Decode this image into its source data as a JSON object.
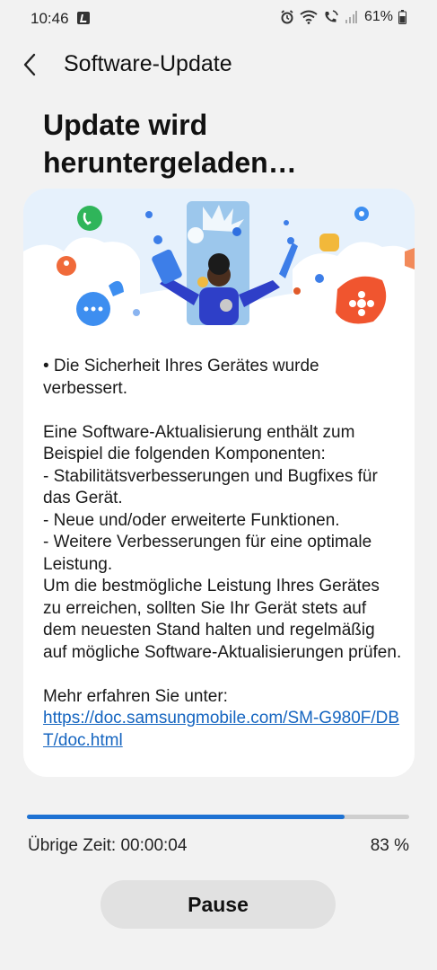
{
  "status_bar": {
    "time": "10:46",
    "battery_percent": "61%",
    "icons": [
      "music-note-icon",
      "alarm-icon",
      "wifi-icon",
      "wifi-call-icon",
      "signal-icon",
      "battery-icon"
    ]
  },
  "header": {
    "title": "Software-Update",
    "back_icon": "chevron-left-icon"
  },
  "headline": "Update wird heruntergeladen…",
  "card": {
    "bullet": "• Die Sicherheit Ihres Gerätes wurde verbessert.",
    "body": "Eine Software-Aktualisierung enthält zum Beispiel die folgenden Komponenten:\n - Stabilitätsverbesserungen und Bugfixes für das Gerät.\n - Neue und/oder erweiterte Funktionen.\n - Weitere Verbesserungen für eine optimale Leistung.\nUm die bestmögliche Leistung Ihres Gerätes zu erreichen, sollten Sie Ihr Gerät stets auf dem neuesten Stand halten und regelmäßig auf mögliche Software-Aktualisierungen prüfen.",
    "more_info": "Mehr erfahren Sie unter:",
    "link": "https://doc.samsungmobile.com/SM-G980F/DBT/doc.html"
  },
  "progress": {
    "value_percent": 83,
    "remaining_label": "Übrige Zeit: 00:00:04",
    "percent_label": "83 %"
  },
  "pause_button": "Pause",
  "colors": {
    "accent": "#1e72d3",
    "link": "#1565c0",
    "background": "#f2f2f2"
  }
}
